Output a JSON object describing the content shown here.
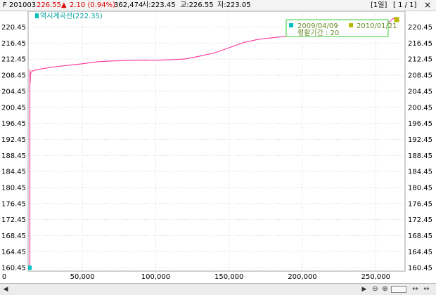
{
  "header": {
    "code": "F 201003",
    "price": "226.55",
    "change_arrow": "▲",
    "change": "2.10 (0.94%)",
    "volume": "362,474",
    "open": "시:223.45",
    "high": "고:226.55",
    "low": "저:223.05",
    "period_button": "[1일]",
    "page_button": "[ 1 / 1]",
    "close_icon": "close-icon"
  },
  "colors": {
    "line": "#ff3399",
    "legend_label": "#00a0a0",
    "info_border": "#33cc33",
    "info_text": "#6a8a2a",
    "marker_start": "#00c0c0",
    "marker_end": "#b8b800",
    "grid": "#d6d6d6"
  },
  "chart_data": {
    "type": "line",
    "series": [
      {
        "name": "역시계곡선(222.35)",
        "x": [
          14200,
          14200,
          14400,
          14600,
          15000,
          16000,
          18000,
          20000,
          25000,
          30000,
          40000,
          50000,
          60000,
          70000,
          80000,
          90000,
          100000,
          110000,
          120000,
          130000,
          140000,
          150000,
          160000,
          170000,
          180000,
          190000,
          200000,
          210000,
          220000,
          230000,
          240000,
          250000,
          256000,
          258000,
          260000,
          262000,
          264000
        ],
        "y": [
          160.45,
          209.8,
          206.5,
          208.6,
          209.2,
          209.5,
          209.75,
          209.9,
          210.2,
          210.5,
          210.9,
          211.3,
          211.8,
          212.0,
          212.1,
          212.2,
          212.2,
          212.3,
          212.5,
          213.2,
          214.0,
          215.3,
          216.6,
          217.4,
          217.8,
          218.2,
          218.5,
          218.8,
          219.2,
          219.7,
          220.1,
          220.3,
          220.7,
          221.2,
          222.0,
          222.6,
          222.4
        ]
      }
    ],
    "y_ticks": [
      "160.45",
      "164.45",
      "168.45",
      "172.45",
      "176.45",
      "180.45",
      "184.45",
      "188.45",
      "192.45",
      "196.45",
      "200.45",
      "204.45",
      "208.45",
      "212.45",
      "216.45",
      "220.45"
    ],
    "x_ticks": [
      "50,000",
      "100,000",
      "150,000",
      "200,000",
      "250,000"
    ],
    "x_tick_values": [
      50000,
      100000,
      150000,
      200000,
      250000
    ],
    "xlim": [
      13000,
      270000
    ],
    "ylim": [
      159.6,
      224.4
    ],
    "grid": true,
    "legend_placement": "top-left",
    "info_box": {
      "start_date": "2009/04/09",
      "separator": "-",
      "end_date": "2010/01/21",
      "period_label": "평활기간 : 20"
    }
  },
  "footer": {
    "nav_left_icon": "triangle-left-icon",
    "nav_right_icon": "triangle-right-icon",
    "zoom_out_icon": "zoom-out-icon",
    "zoom_in_icon": "zoom-in-icon",
    "fit_icon": "fit-arrows-icon"
  }
}
